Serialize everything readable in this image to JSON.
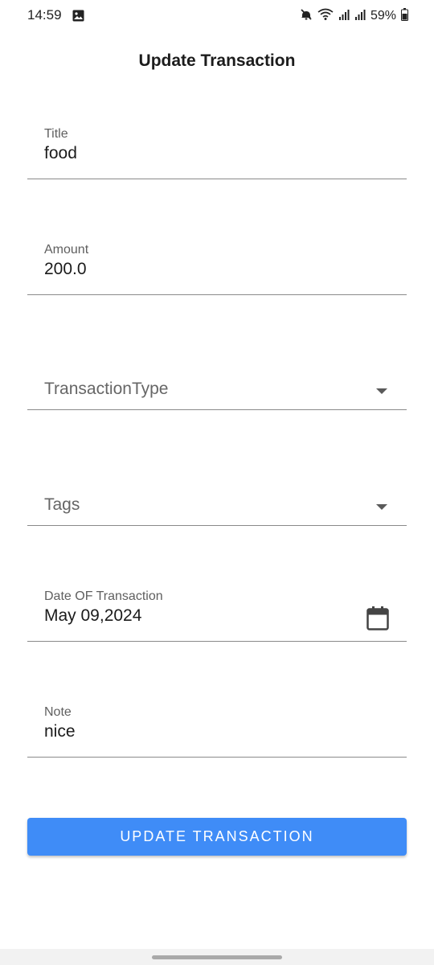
{
  "status_bar": {
    "time": "14:59",
    "battery": "59%",
    "icons": [
      "gallery-icon",
      "mute-icon",
      "wifi-icon",
      "signal-icon",
      "signal-icon",
      "battery-icon"
    ]
  },
  "header": {
    "title": "Update Transaction"
  },
  "form": {
    "title": {
      "label": "Title",
      "value": "food"
    },
    "amount": {
      "label": "Amount",
      "value": "200.0"
    },
    "transaction_type": {
      "placeholder": "TransactionType",
      "icon": "chevron-down-icon"
    },
    "tags": {
      "placeholder": "Tags",
      "icon": "chevron-down-icon"
    },
    "date": {
      "label": "Date OF Transaction",
      "value": "May 09,2024",
      "icon": "calendar-icon"
    },
    "note": {
      "label": "Note",
      "value": "nice"
    }
  },
  "actions": {
    "update_label": "UPDATE TRANSACTION"
  },
  "colors": {
    "accent": "#3f8cf7",
    "divider": "#8a8a8a",
    "label": "#5f5f5f",
    "text": "#1b1b1b"
  }
}
